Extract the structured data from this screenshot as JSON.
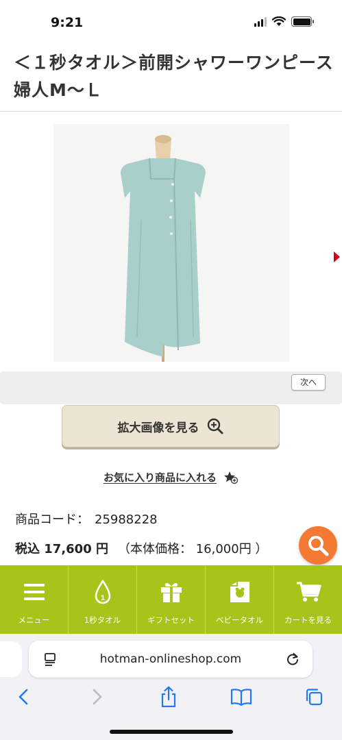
{
  "status_bar": {
    "time": "9:21"
  },
  "product": {
    "title": "＜１秒タオル＞前開シャワーワンピース婦人M〜Ｌ",
    "next_label": "次へ",
    "zoom_label": "拡大画像を見る",
    "favorite_label": "お気に入り商品に入れる",
    "code_label": "商品コード：",
    "code_value": "25988228",
    "price_main": "税込 17,600 円",
    "price_sub": "（本体価格： 16,000円 ）"
  },
  "bottom_nav": {
    "items": [
      {
        "label": "メニュー",
        "icon": "menu-icon"
      },
      {
        "label": "1秒タオル",
        "icon": "drop-icon"
      },
      {
        "label": "ギフトセット",
        "icon": "gift-icon"
      },
      {
        "label": "ベビータオル",
        "icon": "baby-towel-icon"
      },
      {
        "label": "カートを見る",
        "icon": "cart-icon"
      }
    ]
  },
  "browser": {
    "url": "hotman-onlineshop.com"
  },
  "colors": {
    "accent_green": "#a6c41a",
    "search_orange": "#f47a33",
    "zoom_button_bg": "#ece5d3",
    "link_blue": "#1e7af0"
  }
}
